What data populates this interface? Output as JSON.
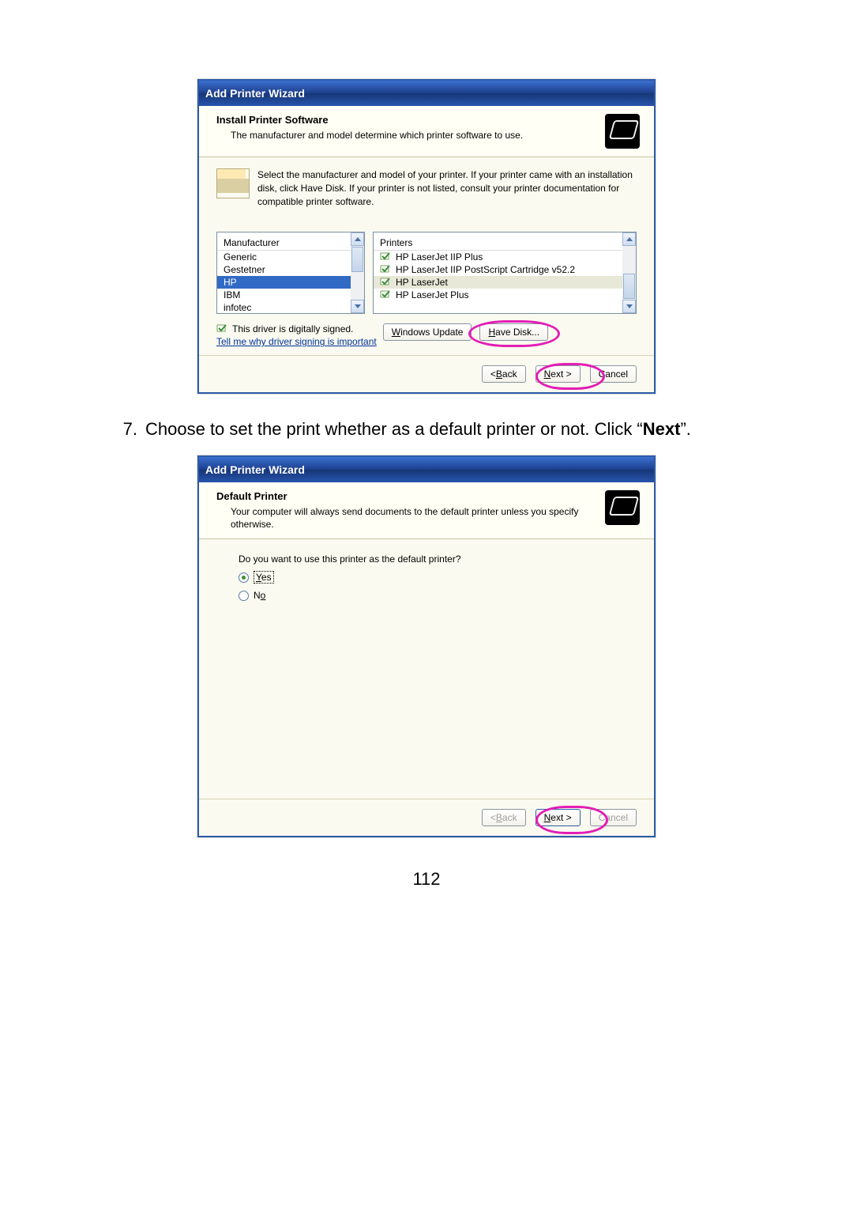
{
  "dialog1": {
    "title": "Add Printer Wizard",
    "header": {
      "title": "Install Printer Software",
      "subtitle": "The manufacturer and model determine which printer software to use."
    },
    "info_text": "Select the manufacturer and model of your printer. If your printer came with an installation disk, click Have Disk. If your printer is not listed, consult your printer documentation for compatible printer software.",
    "manufacturer_header": "Manufacturer",
    "manufacturers": [
      "Generic",
      "Gestetner",
      "HP",
      "IBM",
      "infotec"
    ],
    "manufacturer_selected_index": 2,
    "printers_header": "Printers",
    "printers": [
      "HP LaserJet IIP Plus",
      "HP LaserJet IIP PostScript Cartridge v52.2",
      "HP LaserJet",
      "HP LaserJet Plus"
    ],
    "printer_selected_index": 2,
    "sign_text": "This driver is digitally signed.",
    "sign_link": "Tell me why driver signing is important",
    "windows_update_btn": "Windows Update",
    "have_disk_btn": "Have Disk...",
    "back_btn": "< Back",
    "next_btn": "Next >",
    "cancel_btn": "Cancel"
  },
  "step": {
    "number": "7.",
    "text_a": "Choose to set the print whether as a default printer or not. Click “",
    "text_bold": "Next",
    "text_b": "”."
  },
  "dialog2": {
    "title": "Add Printer Wizard",
    "header": {
      "title": "Default Printer",
      "subtitle": "Your computer will always send documents to the default printer unless you specify otherwise."
    },
    "question": "Do you want to use this printer as the default printer?",
    "yes_label": "Yes",
    "no_label": "No",
    "back_btn": "< Back",
    "next_btn": "Next >",
    "cancel_btn": "Cancel"
  },
  "page_number": "112"
}
